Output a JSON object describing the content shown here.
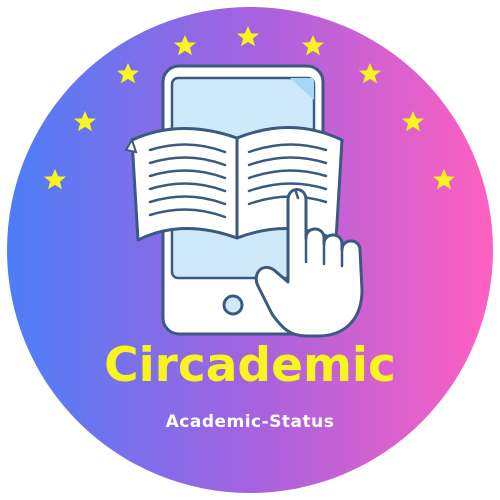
{
  "logo": {
    "title": "Circademic",
    "subtitle": "Academic-Status",
    "icons": [
      "star-icon",
      "tablet-icon",
      "open-book-icon",
      "pointing-hand-icon"
    ],
    "colors": {
      "gradient_start": "#4f7cf7",
      "gradient_mid": "#a45fe0",
      "gradient_end": "#ff5fbf",
      "star": "#f7f51d",
      "title": "#f7f51d",
      "subtitle": "#ffffff",
      "tablet_screen": "#cfe9fb",
      "outline": "#3a5a80"
    }
  }
}
